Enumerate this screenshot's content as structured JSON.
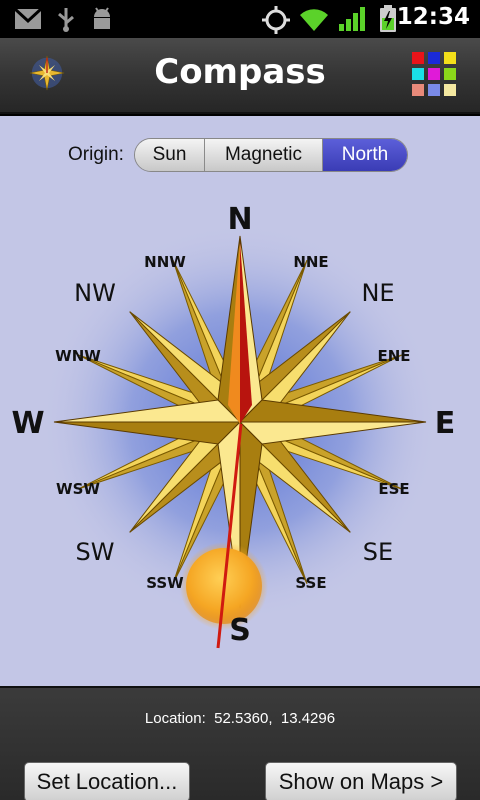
{
  "status_bar": {
    "time": "12:34",
    "left_icons": [
      "gmail-icon",
      "usb-icon",
      "android-debug-icon"
    ],
    "right_icons": [
      "gps-icon",
      "wifi-icon",
      "signal-icon",
      "battery-charging-icon"
    ]
  },
  "title_bar": {
    "title": "Compass",
    "app_icon": "compass-star-icon",
    "menu_icon": "color-grid-icon"
  },
  "origin": {
    "label": "Origin:",
    "options": [
      "Sun",
      "Magnetic",
      "North"
    ],
    "selected": "North"
  },
  "compass": {
    "directions": {
      "n": "N",
      "nne": "NNE",
      "ne": "NE",
      "ene": "ENE",
      "e": "E",
      "ese": "ESE",
      "se": "SE",
      "sse": "SSE",
      "s": "S",
      "ssw": "SSW",
      "sw": "SW",
      "wsw": "WSW",
      "w": "W",
      "wnw": "WNW",
      "nw": "NW",
      "nnw": "NNW"
    },
    "needle_color": "#d01a10",
    "sun_color": "#f5a623"
  },
  "footer": {
    "location_label": "Location:",
    "latitude": "52.5360,",
    "longitude": "13.4296",
    "set_location_button": "Set Location...",
    "show_on_maps_button": "Show on Maps >"
  }
}
